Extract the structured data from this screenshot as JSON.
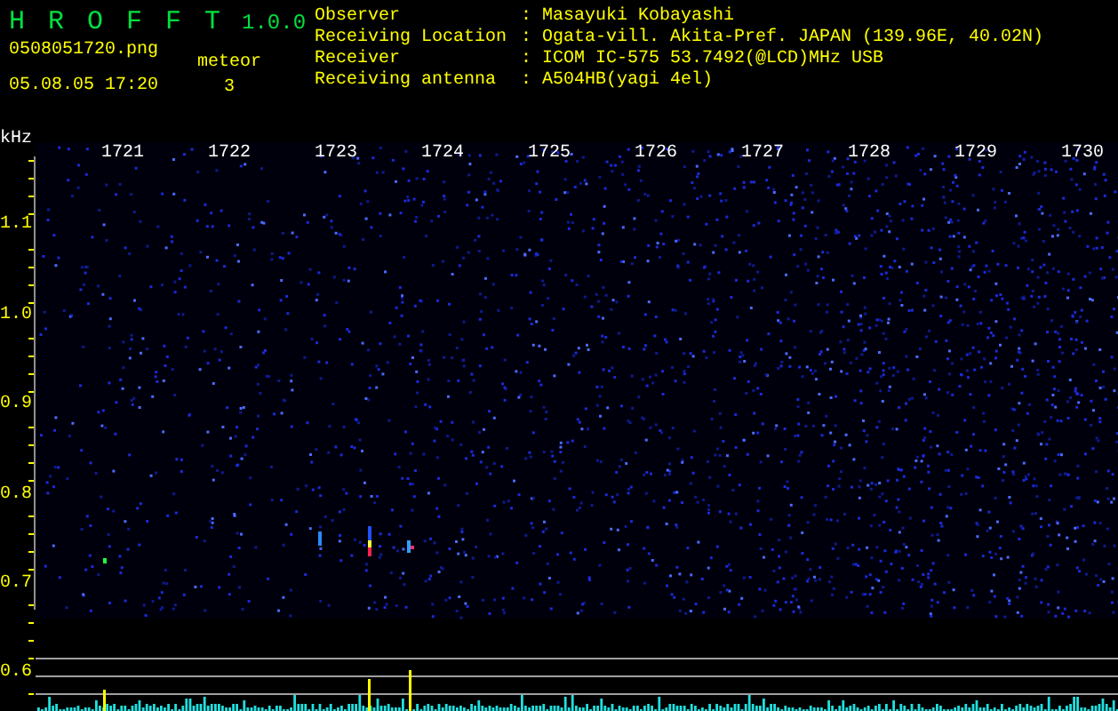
{
  "header": {
    "title": "H R O F F T",
    "version": "1.0.0",
    "file_name": "0508051720.png",
    "date_time": "05.08.05 17:20",
    "meteor_label": "meteor",
    "meteor_count": "3"
  },
  "info": [
    {
      "label": "Observer",
      "separator": ":",
      "value": "Masayuki Kobayashi"
    },
    {
      "label": "Receiving Location",
      "separator": ":",
      "value": "Ogata-vill. Akita-Pref. JAPAN (139.96E, 40.02N)"
    },
    {
      "label": "Receiver",
      "separator": ":",
      "value": "ICOM IC-575 53.7492(@LCD)MHz USB"
    },
    {
      "label": "Receiving antenna",
      "separator": ":",
      "value": "A504HB(yagi 4el)"
    }
  ],
  "plot": {
    "y_unit": "kHz",
    "x_labels": [
      "1721",
      "1722",
      "1723",
      "1724",
      "1725",
      "1726",
      "1727",
      "1728",
      "1729",
      "1730"
    ],
    "y_labels": [
      "1.1",
      "1.0",
      "0.9",
      "0.8",
      "0.7",
      "0.6"
    ]
  }
}
